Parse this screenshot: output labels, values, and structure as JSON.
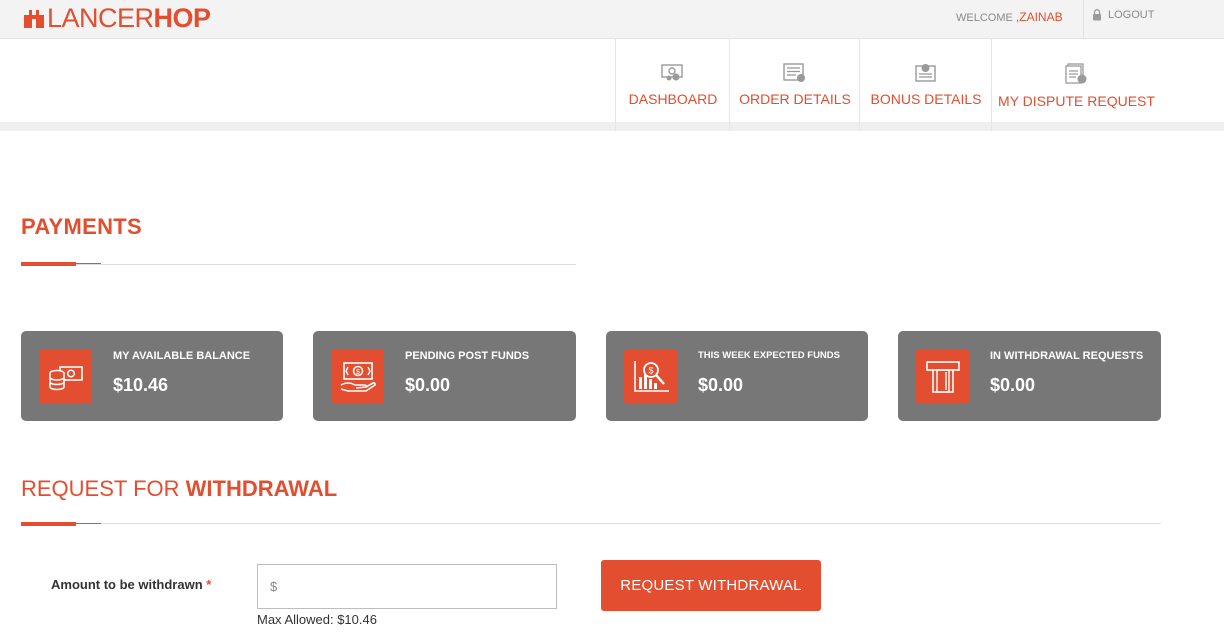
{
  "brand": {
    "logo_text_light": "LANCER",
    "logo_text_bold": "HOP",
    "accent_color": "#e24e2f"
  },
  "header": {
    "welcome_label": "WELCOME",
    "user_name": ",ZAINAB",
    "logout_label": "LOGOUT"
  },
  "nav": {
    "items": [
      {
        "label": "DASHBOARD",
        "icon": "dashboard-icon"
      },
      {
        "label": "ORDER DETAILS",
        "icon": "order-details-icon"
      },
      {
        "label": "BONUS DETAILS",
        "icon": "bonus-details-icon"
      },
      {
        "label": "MY DISPUTE REQUEST",
        "icon": "dispute-request-icon"
      }
    ]
  },
  "payments": {
    "title": "PAYMENTS",
    "cards": [
      {
        "label": "MY AVAILABLE BALANCE",
        "value": "$10.46",
        "icon": "money-coins-icon"
      },
      {
        "label": "PENDING POST FUNDS",
        "value": "$0.00",
        "icon": "cash-hand-icon"
      },
      {
        "label": "THIS WEEK EXPECTED FUNDS",
        "value": "$0.00",
        "icon": "chart-search-icon"
      },
      {
        "label": "IN WITHDRAWAL REQUESTS",
        "value": "$0.00",
        "icon": "atm-card-icon"
      }
    ]
  },
  "withdrawal": {
    "title_light": "REQUEST FOR ",
    "title_bold": "WITHDRAWAL",
    "amount_label": "Amount to be withdrawn",
    "required_mark": "*",
    "amount_placeholder": "$",
    "max_allowed": "Max Allowed: $10.46",
    "button_label": "REQUEST WITHDRAWAL"
  }
}
